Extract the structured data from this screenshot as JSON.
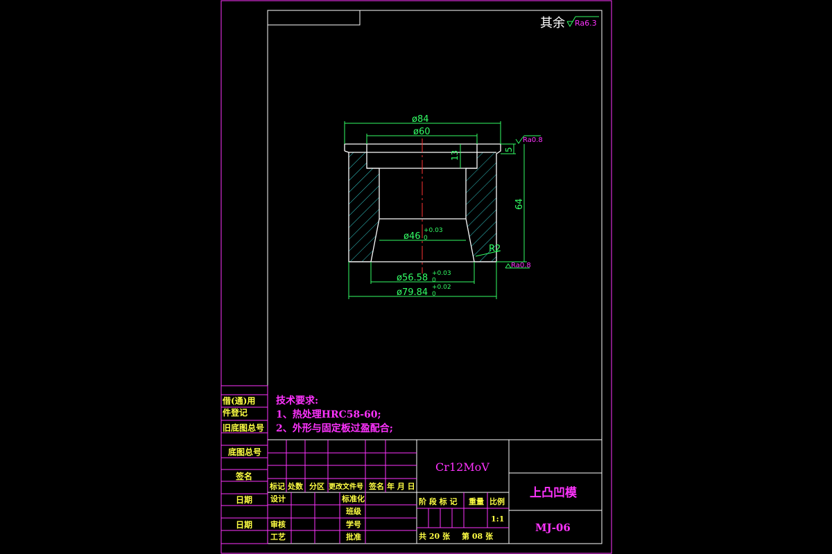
{
  "surface_note": {
    "label": "其余",
    "roughness": "Ra6.3"
  },
  "part": {
    "dims": {
      "outer_flange_dia": "ø84",
      "counterbore_dia": "ø60",
      "counterbore_depth": "13",
      "flange_height": "5",
      "total_height": "64",
      "bore_dia": "ø46",
      "bore_tol": "+0.03",
      "bore_tol_low": "0",
      "cone_dia": "ø56.58",
      "cone_tol": "+0.03",
      "cone_tol_low": "0",
      "outer_dia": "ø79.84",
      "outer_tol": "+0.02",
      "outer_tol_low": "0",
      "radius": "R2",
      "top_roughness": "Ra0.8",
      "bottom_roughness": "Ra0.8"
    }
  },
  "tech_requirements": {
    "title": "技术要求:",
    "item1": "1、热处理HRC58-60;",
    "item2": "2、外形与固定板过盈配合;"
  },
  "left_strip": {
    "l1": "借(通)用",
    "l2": "件登记",
    "l3": "旧底图总号",
    "l4": "底图总号",
    "l5": "签名",
    "l6": "日期",
    "l7": "日期"
  },
  "title_block": {
    "material": "Cr12MoV",
    "part_name": "上凸凹模",
    "drawing_no": "MJ-06",
    "rev_headers": [
      "标记",
      "处数",
      "分区",
      "更改文件号",
      "签名",
      "年 月 日"
    ],
    "design": "设计",
    "standardize": "标准化",
    "check": "审核",
    "craft": "工艺",
    "approve": "批准",
    "proofread": "班级",
    "student_no": "学号",
    "stage_headers": [
      "阶 段 标 记",
      "重量",
      "比例"
    ],
    "scale": "1:1",
    "sheets": "共 20 张",
    "sheet_no": "第 08 张"
  }
}
